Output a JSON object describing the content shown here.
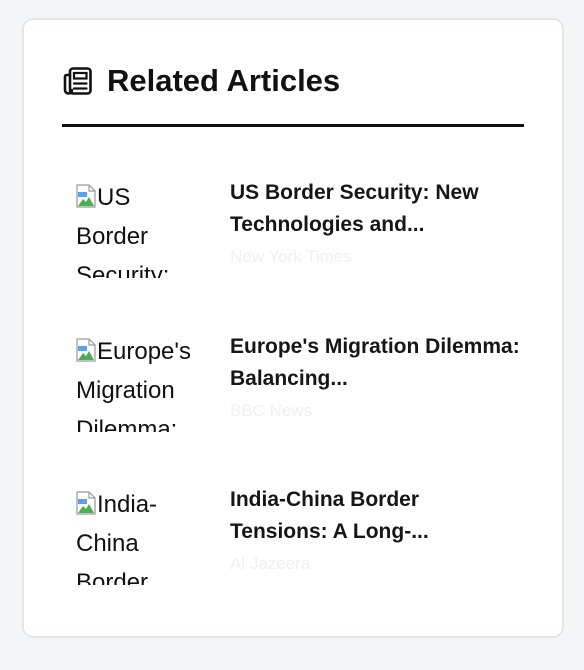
{
  "widget": {
    "title": "Related Articles",
    "icon": "newspaper-icon"
  },
  "articles": [
    {
      "image_alt": "US Border Security:",
      "title": "US Border Security: New Technologies and...",
      "source": "New York Times"
    },
    {
      "image_alt": "Europe's Migration Dilemma:",
      "title": "Europe's Migration Dilemma: Balancing...",
      "source": "BBC News"
    },
    {
      "image_alt": "India-China Border",
      "title": "India-China Border Tensions: A Long-...",
      "source": "Al Jazeera"
    }
  ],
  "colors": {
    "header_rule": "#111111",
    "title_text": "#161616",
    "source_text": "#f0f0f0",
    "card_border": "#e3e5e8"
  }
}
